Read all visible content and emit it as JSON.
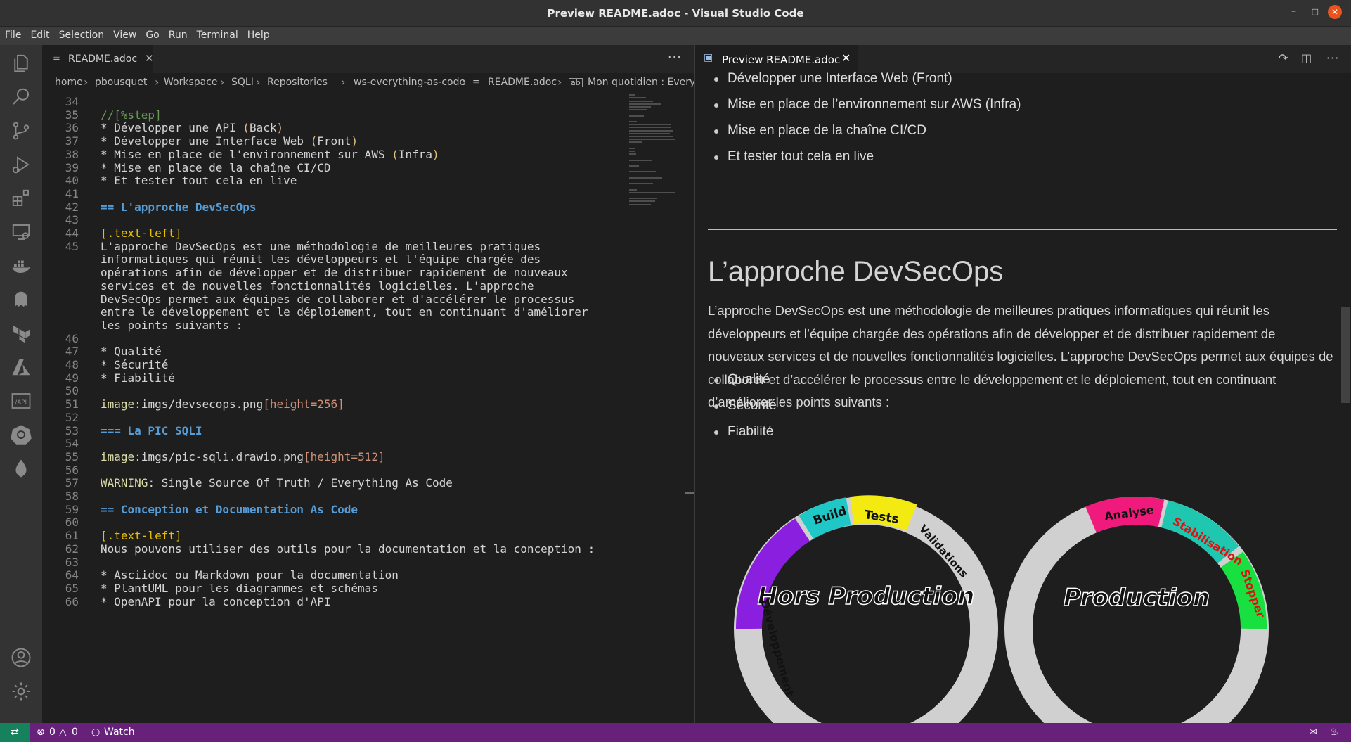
{
  "window": {
    "title": "Preview README.adoc - Visual Studio Code"
  },
  "menu": [
    "File",
    "Edit",
    "Selection",
    "View",
    "Go",
    "Run",
    "Terminal",
    "Help"
  ],
  "editor": {
    "tab": {
      "label": "README.adoc"
    },
    "breadcrumb": [
      "home",
      "pbousquet",
      "Workspace",
      "SQLI",
      "Repositories",
      "ws-everything-as-code",
      "README.adoc",
      "Mon quotidien : Every"
    ],
    "lines": [
      {
        "n": "34",
        "parts": []
      },
      {
        "n": "35",
        "parts": [
          {
            "t": "//[%step]",
            "c": "comment"
          }
        ]
      },
      {
        "n": "36",
        "parts": [
          {
            "t": "* Développer une API "
          },
          {
            "t": "(",
            "c": "paren"
          },
          {
            "t": "Back"
          },
          {
            "t": ")",
            "c": "paren"
          }
        ]
      },
      {
        "n": "37",
        "parts": [
          {
            "t": "* Développer une Interface Web "
          },
          {
            "t": "(",
            "c": "paren"
          },
          {
            "t": "Front"
          },
          {
            "t": ")",
            "c": "paren"
          }
        ]
      },
      {
        "n": "38",
        "parts": [
          {
            "t": "* Mise en place de l'environnement sur AWS "
          },
          {
            "t": "(",
            "c": "paren"
          },
          {
            "t": "Infra"
          },
          {
            "t": ")",
            "c": "paren"
          }
        ]
      },
      {
        "n": "39",
        "parts": [
          {
            "t": "* Mise en place de la chaîne CI/CD"
          }
        ]
      },
      {
        "n": "40",
        "parts": [
          {
            "t": "* Et tester tout cela en live"
          }
        ]
      },
      {
        "n": "41",
        "parts": []
      },
      {
        "n": "42",
        "parts": [
          {
            "t": "== L'approche DevSecOps",
            "c": "head"
          }
        ]
      },
      {
        "n": "43",
        "parts": []
      },
      {
        "n": "44",
        "parts": [
          {
            "t": "[.text-left]",
            "c": "attr"
          }
        ]
      },
      {
        "n": "45",
        "parts": [
          {
            "t": "L'approche DevSecOps est une méthodologie de meilleures pratiques"
          }
        ]
      },
      {
        "n": "",
        "parts": [
          {
            "t": "informatiques qui réunit les développeurs et l'équipe chargée des"
          }
        ]
      },
      {
        "n": "",
        "parts": [
          {
            "t": "opérations afin de développer et de distribuer rapidement de nouveaux"
          }
        ]
      },
      {
        "n": "",
        "parts": [
          {
            "t": "services et de nouvelles fonctionnalités logicielles. L'approche"
          }
        ]
      },
      {
        "n": "",
        "parts": [
          {
            "t": "DevSecOps permet aux équipes de collaborer et d'accélérer le processus"
          }
        ]
      },
      {
        "n": "",
        "parts": [
          {
            "t": "entre le développement et le déploiement, tout en continuant d'améliorer"
          }
        ]
      },
      {
        "n": "",
        "parts": [
          {
            "t": "les points suivants :"
          }
        ]
      },
      {
        "n": "46",
        "parts": []
      },
      {
        "n": "47",
        "parts": [
          {
            "t": "* Qualité"
          }
        ]
      },
      {
        "n": "48",
        "parts": [
          {
            "t": "* Sécurité"
          }
        ]
      },
      {
        "n": "49",
        "parts": [
          {
            "t": "* Fiabilité"
          }
        ]
      },
      {
        "n": "50",
        "parts": []
      },
      {
        "n": "51",
        "parts": [
          {
            "t": "image",
            "c": "kw"
          },
          {
            "t": ":imgs/devsecops.png"
          },
          {
            "t": "[height=256]",
            "c": "attrval"
          }
        ]
      },
      {
        "n": "52",
        "parts": []
      },
      {
        "n": "53",
        "parts": [
          {
            "t": "=== La PIC SQLI",
            "c": "head"
          }
        ]
      },
      {
        "n": "54",
        "parts": []
      },
      {
        "n": "55",
        "parts": [
          {
            "t": "image",
            "c": "kw"
          },
          {
            "t": ":imgs/pic-sqli.drawio.png"
          },
          {
            "t": "[height=512]",
            "c": "attrval"
          }
        ]
      },
      {
        "n": "56",
        "parts": []
      },
      {
        "n": "57",
        "parts": [
          {
            "t": "WARNING",
            "c": "kw"
          },
          {
            "t": ": Single Source Of Truth / Everything As Code"
          }
        ]
      },
      {
        "n": "58",
        "parts": []
      },
      {
        "n": "59",
        "parts": [
          {
            "t": "== Conception et Documentation As Code",
            "c": "head"
          }
        ]
      },
      {
        "n": "60",
        "parts": []
      },
      {
        "n": "61",
        "parts": [
          {
            "t": "[.text-left]",
            "c": "attr"
          }
        ]
      },
      {
        "n": "62",
        "parts": [
          {
            "t": "Nous pouvons utiliser des outils pour la documentation et la conception :"
          }
        ]
      },
      {
        "n": "63",
        "parts": []
      },
      {
        "n": "64",
        "parts": [
          {
            "t": "* Asciidoc ou Markdown pour la documentation"
          }
        ]
      },
      {
        "n": "65",
        "parts": [
          {
            "t": "* PlantUML pour les diagrammes et schémas"
          }
        ]
      },
      {
        "n": "66",
        "parts": [
          {
            "t": "* OpenAPI pour la conception d'API"
          }
        ]
      }
    ]
  },
  "preview": {
    "tab": {
      "label": "Preview README.adoc"
    },
    "top_bullets": [
      "Développer une Interface Web (Front)",
      "Mise en place de l’environnement sur AWS (Infra)",
      "Mise en place de la chaîne CI/CD",
      "Et tester tout cela en live"
    ],
    "heading": "L’approche DevSecOps",
    "paragraph": "L’approche DevSecOps est une méthodologie de meilleures pratiques informatiques qui réunit les développeurs et l’équipe chargée des opérations afin de développer et de distribuer rapidement de nouveaux services et de nouvelles fonctionnalités logicielles. L’approche DevSecOps permet aux équipes de collaborer et d’accélérer le processus entre le développement et le déploiement, tout en continuant d’améliorer les points suivants :",
    "bullets": [
      "Qualité",
      "Sécurité",
      "Fiabilité"
    ],
    "diagram": {
      "left_title": "Hors Production",
      "right_title": "Production",
      "left_segments": [
        "Développement",
        "Build",
        "Tests",
        "Validations"
      ],
      "right_segments": [
        "Analyse",
        "Stabilisation",
        "Stopper"
      ]
    }
  },
  "statusbar": {
    "errors": "0",
    "warnings": "0",
    "watch": "Watch"
  }
}
